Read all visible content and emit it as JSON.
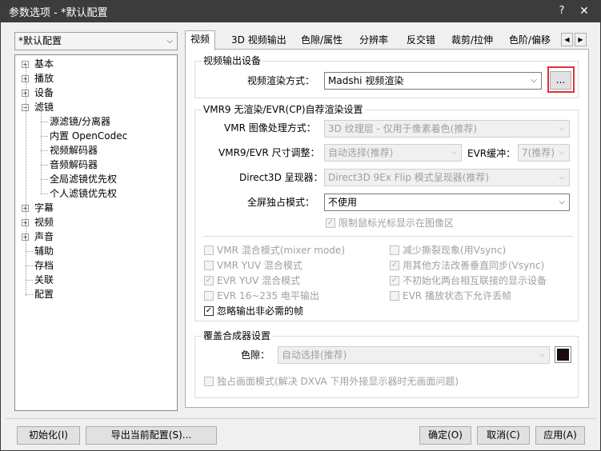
{
  "window": {
    "title": "参数选项 - *默认配置",
    "help_glyph": "?",
    "close_glyph": "✕"
  },
  "profile": {
    "selected": "*默认配置"
  },
  "tree": [
    {
      "label": "基本",
      "expandable": true
    },
    {
      "label": "播放",
      "expandable": true
    },
    {
      "label": "设备",
      "expandable": true
    },
    {
      "label": "滤镜",
      "expandable": true,
      "expanded": true
    },
    {
      "label": "源滤镜/分离器",
      "child": true
    },
    {
      "label": "内置 OpenCodec",
      "child": true
    },
    {
      "label": "视频解码器",
      "child": true
    },
    {
      "label": "音频解码器",
      "child": true
    },
    {
      "label": "全局滤镜优先权",
      "child": true
    },
    {
      "label": "个人滤镜优先权",
      "child": true
    },
    {
      "label": "字幕",
      "expandable": true
    },
    {
      "label": "视频",
      "expandable": true
    },
    {
      "label": "声音",
      "expandable": true
    },
    {
      "label": "辅助"
    },
    {
      "label": "存档"
    },
    {
      "label": "关联"
    },
    {
      "label": "配置"
    }
  ],
  "tabs": [
    "视频",
    "3D 视频输出",
    "色隙/属性",
    "分辨率",
    "反交错",
    "裁剪/拉伸",
    "色阶/偏移"
  ],
  "tab_scroll": {
    "left": "◀",
    "right": "▶"
  },
  "video_output": {
    "group_label": "视频输出设备",
    "render_label": "视频渲染方式：",
    "render_value": "Madshi 视频渲染",
    "browse_label": "..."
  },
  "vmr9": {
    "group_label": "VMR9 无渲染/EVR(CP)自荐渲染设置",
    "processing_label": "VMR 图像处理方式：",
    "processing_value": "3D 纹理层 - 仅用于像素着色(推荐)",
    "resize_label": "VMR9/EVR 尺寸调整：",
    "resize_value": "自动选择(推荐)",
    "evr_buffer_label": "EVR缓冲：",
    "evr_buffer_value": "7(推荐)",
    "d3d_label": "Direct3D 呈现器：",
    "d3d_value": "Direct3D 9Ex Flip 模式呈现器(推荐)",
    "fullscreen_label": "全屏独占模式：",
    "fullscreen_value": "不使用",
    "limit_cursor": {
      "label": "限制鼠标光标显示在图像区",
      "checked": true,
      "enabled": false
    },
    "options_left": [
      {
        "label": "VMR 混合模式(mixer mode)",
        "checked": false,
        "enabled": false
      },
      {
        "label": "VMR YUV 混合模式",
        "checked": false,
        "enabled": false
      },
      {
        "label": "EVR YUV 混合模式",
        "checked": true,
        "enabled": false
      },
      {
        "label": "EVR 16~235 电平输出",
        "checked": false,
        "enabled": false
      },
      {
        "label": "忽略输出非必需的帧",
        "checked": true,
        "enabled": true
      }
    ],
    "options_right": [
      {
        "label": "减少撕裂现象(用Vsync)",
        "checked": false,
        "enabled": false
      },
      {
        "label": "用其他方法改善垂直同步(Vsync)",
        "checked": true,
        "enabled": false
      },
      {
        "label": "不初始化两台相互联接的显示设备",
        "checked": true,
        "enabled": false
      },
      {
        "label": "EVR 播放状态下允许丢帧",
        "checked": false,
        "enabled": false
      }
    ]
  },
  "overlay": {
    "group_label": "覆盖合成器设置",
    "color_label": "色隙：",
    "color_value": "自动选择(推荐)",
    "swatch_color": "#1a0a14",
    "exclusive": {
      "label": "独占画面模式(解决 DXVA 下用外接显示器时无画面问题)",
      "checked": false,
      "enabled": false
    }
  },
  "footer": {
    "init_label": "初始化(I)",
    "export_label": "导出当前配置(S)...",
    "ok_label": "确定(O)",
    "cancel_label": "取消(C)",
    "apply_label": "应用(A)"
  },
  "check_glyph": "✓",
  "chevron_glyph": "⌵",
  "plus_glyph": "+",
  "minus_glyph": "−"
}
